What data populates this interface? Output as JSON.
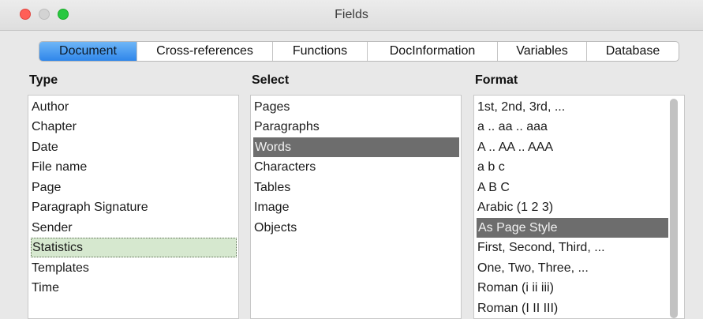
{
  "window": {
    "title": "Fields"
  },
  "tabs": [
    {
      "label": "Document"
    },
    {
      "label": "Cross-references"
    },
    {
      "label": "Functions"
    },
    {
      "label": "DocInformation"
    },
    {
      "label": "Variables"
    },
    {
      "label": "Database"
    }
  ],
  "active_tab": "Document",
  "type_column": {
    "header": "Type",
    "items": [
      "Author",
      "Chapter",
      "Date",
      "File name",
      "Page",
      "Paragraph Signature",
      "Sender",
      "Statistics",
      "Templates",
      "Time"
    ],
    "selected": "Statistics"
  },
  "select_column": {
    "header": "Select",
    "items": [
      "Pages",
      "Paragraphs",
      "Words",
      "Characters",
      "Tables",
      "Image",
      "Objects"
    ],
    "selected": "Words"
  },
  "format_column": {
    "header": "Format",
    "items": [
      "1st, 2nd, 3rd, ...",
      "a .. aa .. aaa",
      "A .. AA .. AAA",
      "a b c",
      "A B C",
      "Arabic (1 2 3)",
      "As Page Style",
      "First, Second, Third, ...",
      "One, Two, Three, ...",
      "Roman (i ii iii)",
      "Roman (I II III)"
    ],
    "selected": "As Page Style"
  },
  "colors": {
    "active_tab": "#2f86ea",
    "selection_gray": "#6d6d6d",
    "selection_focus": "#d6e8cf"
  }
}
